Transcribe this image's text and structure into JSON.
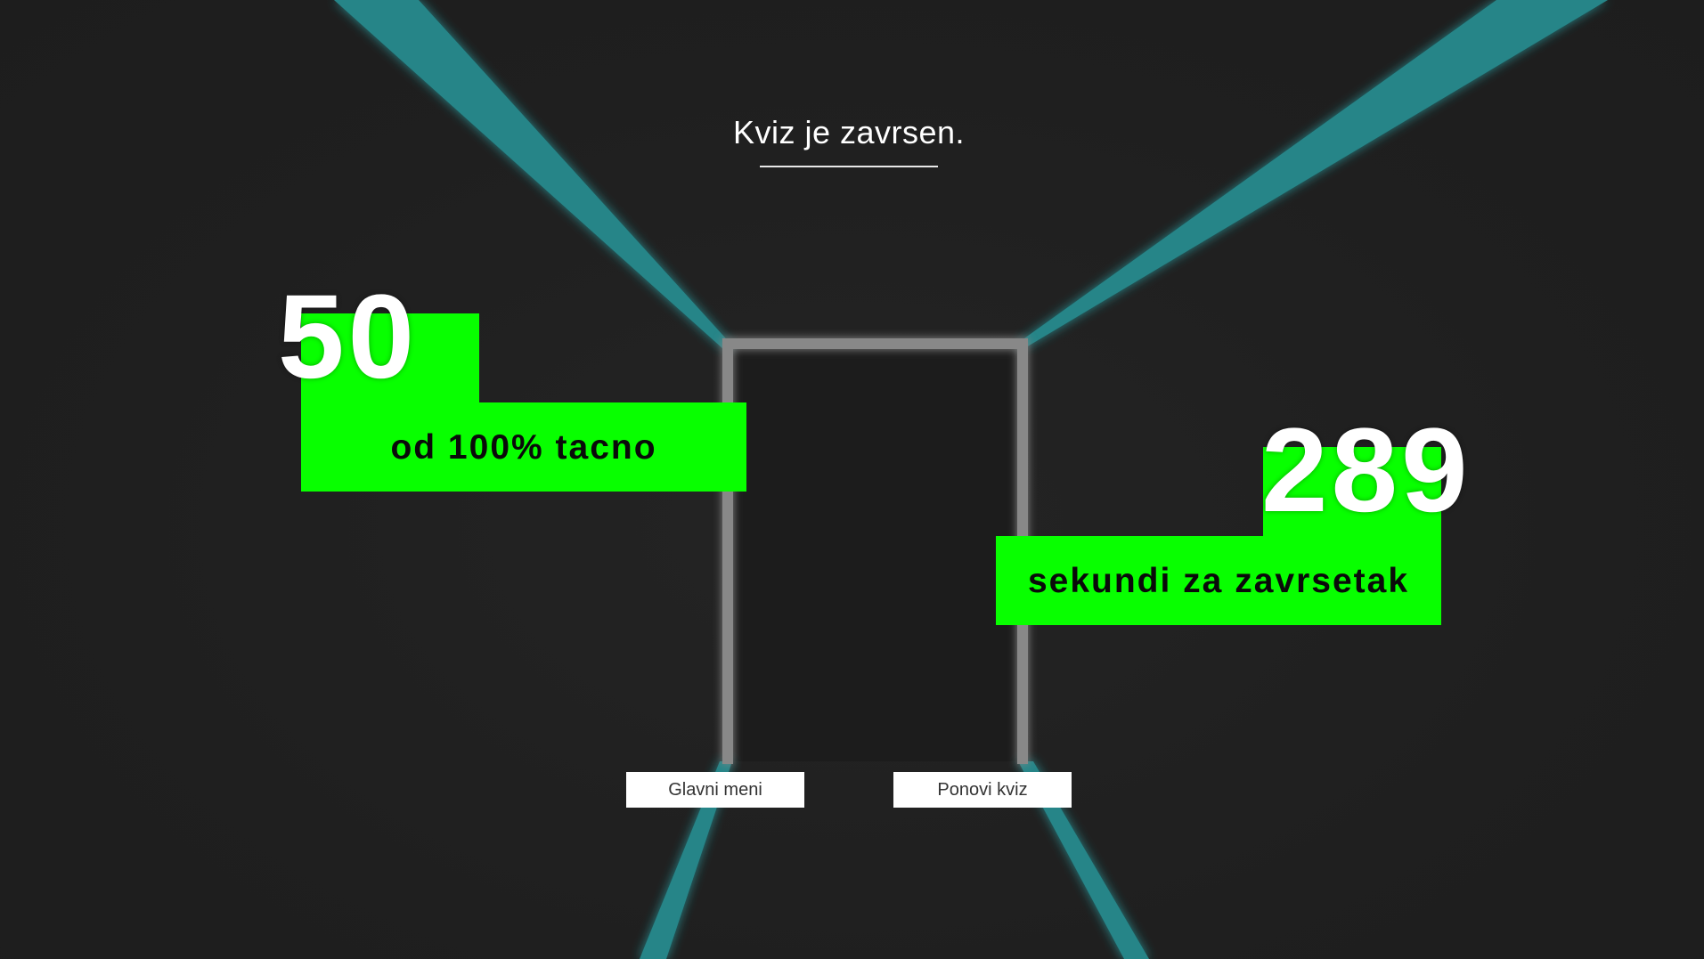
{
  "quiz_result": {
    "title": "Kviz je zavrsen.",
    "score": {
      "value": "50",
      "label": "od 100% tacno"
    },
    "time": {
      "value": "289",
      "label": "sekundi za zavrsetak"
    }
  },
  "buttons": {
    "main_menu": "Glavni meni",
    "retry": "Ponovi kviz"
  },
  "colors": {
    "background": "#202020",
    "accent_green": "#08ff00",
    "corridor_teal": "#2a8a8c",
    "door_frame": "#8a8a8a"
  }
}
